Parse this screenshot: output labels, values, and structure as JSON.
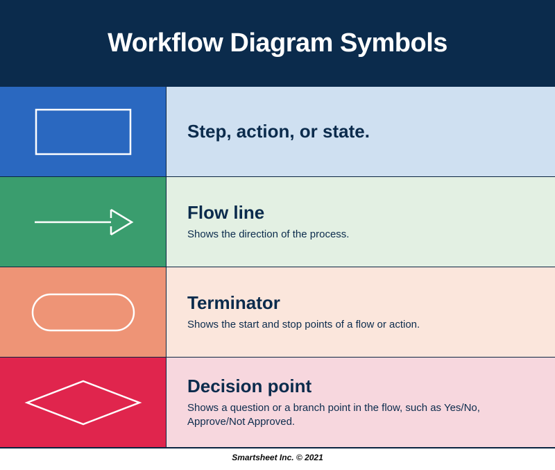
{
  "header": {
    "title": "Workflow Diagram Symbols"
  },
  "rows": [
    {
      "symbol": "rectangle",
      "title": "Step, action, or state.",
      "subtitle": ""
    },
    {
      "symbol": "arrow",
      "title": "Flow line",
      "subtitle": "Shows the direction of the process."
    },
    {
      "symbol": "rounded",
      "title": "Terminator",
      "subtitle": "Shows the start and stop points of a flow or action."
    },
    {
      "symbol": "diamond",
      "title": "Decision point",
      "subtitle": "Shows a question or a branch point in the flow, such as Yes/No, Approve/Not Approved."
    }
  ],
  "footer": {
    "text": "Smartsheet Inc. © 2021"
  }
}
